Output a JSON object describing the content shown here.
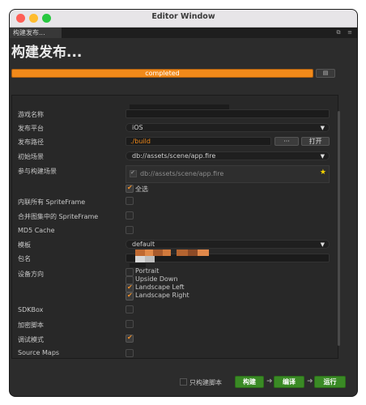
{
  "window": {
    "title": "Editor Window"
  },
  "tab": {
    "label": "构建发布..."
  },
  "heading": "构建发布...",
  "progress": {
    "status": "completed",
    "fraction": 1.0
  },
  "fields": {
    "game_name": {
      "label": "游戏名称"
    },
    "platform": {
      "label": "发布平台",
      "value": "iOS"
    },
    "build_path": {
      "label": "发布路径",
      "value": "./build",
      "browse_label": "···",
      "open_label": "打开"
    },
    "start_scene": {
      "label": "初始场景",
      "value": "db://assets/scene/app.fire"
    },
    "included_scenes": {
      "label": "参与构建场景",
      "scene": "db://assets/scene/app.fire",
      "select_all_label": "全选"
    },
    "inline_spriteframe": {
      "label": "内联所有 SpriteFrame"
    },
    "merge_spriteframe": {
      "label": "合并图集中的 SpriteFrame"
    },
    "md5_cache": {
      "label": "MD5 Cache"
    },
    "template": {
      "label": "模板",
      "value": "default"
    },
    "package": {
      "label": "包名"
    },
    "orientation": {
      "label": "设备方向",
      "options": [
        {
          "label": "Portrait",
          "checked": false
        },
        {
          "label": "Upside Down",
          "checked": false
        },
        {
          "label": "Landscape Left",
          "checked": true
        },
        {
          "label": "Landscape Right",
          "checked": true
        }
      ]
    },
    "sdkbox": {
      "label": "SDKBox"
    },
    "encrypt": {
      "label": "加密脚本"
    },
    "debug": {
      "label": "调试模式"
    },
    "source_maps": {
      "label": "Source Maps"
    }
  },
  "footer": {
    "only_build_label": "只构建脚本",
    "build_label": "构建",
    "compile_label": "编译",
    "run_label": "运行"
  },
  "colors": {
    "accent": "#f28a1a",
    "action_green": "#3a8a25",
    "star": "#f5d300"
  }
}
